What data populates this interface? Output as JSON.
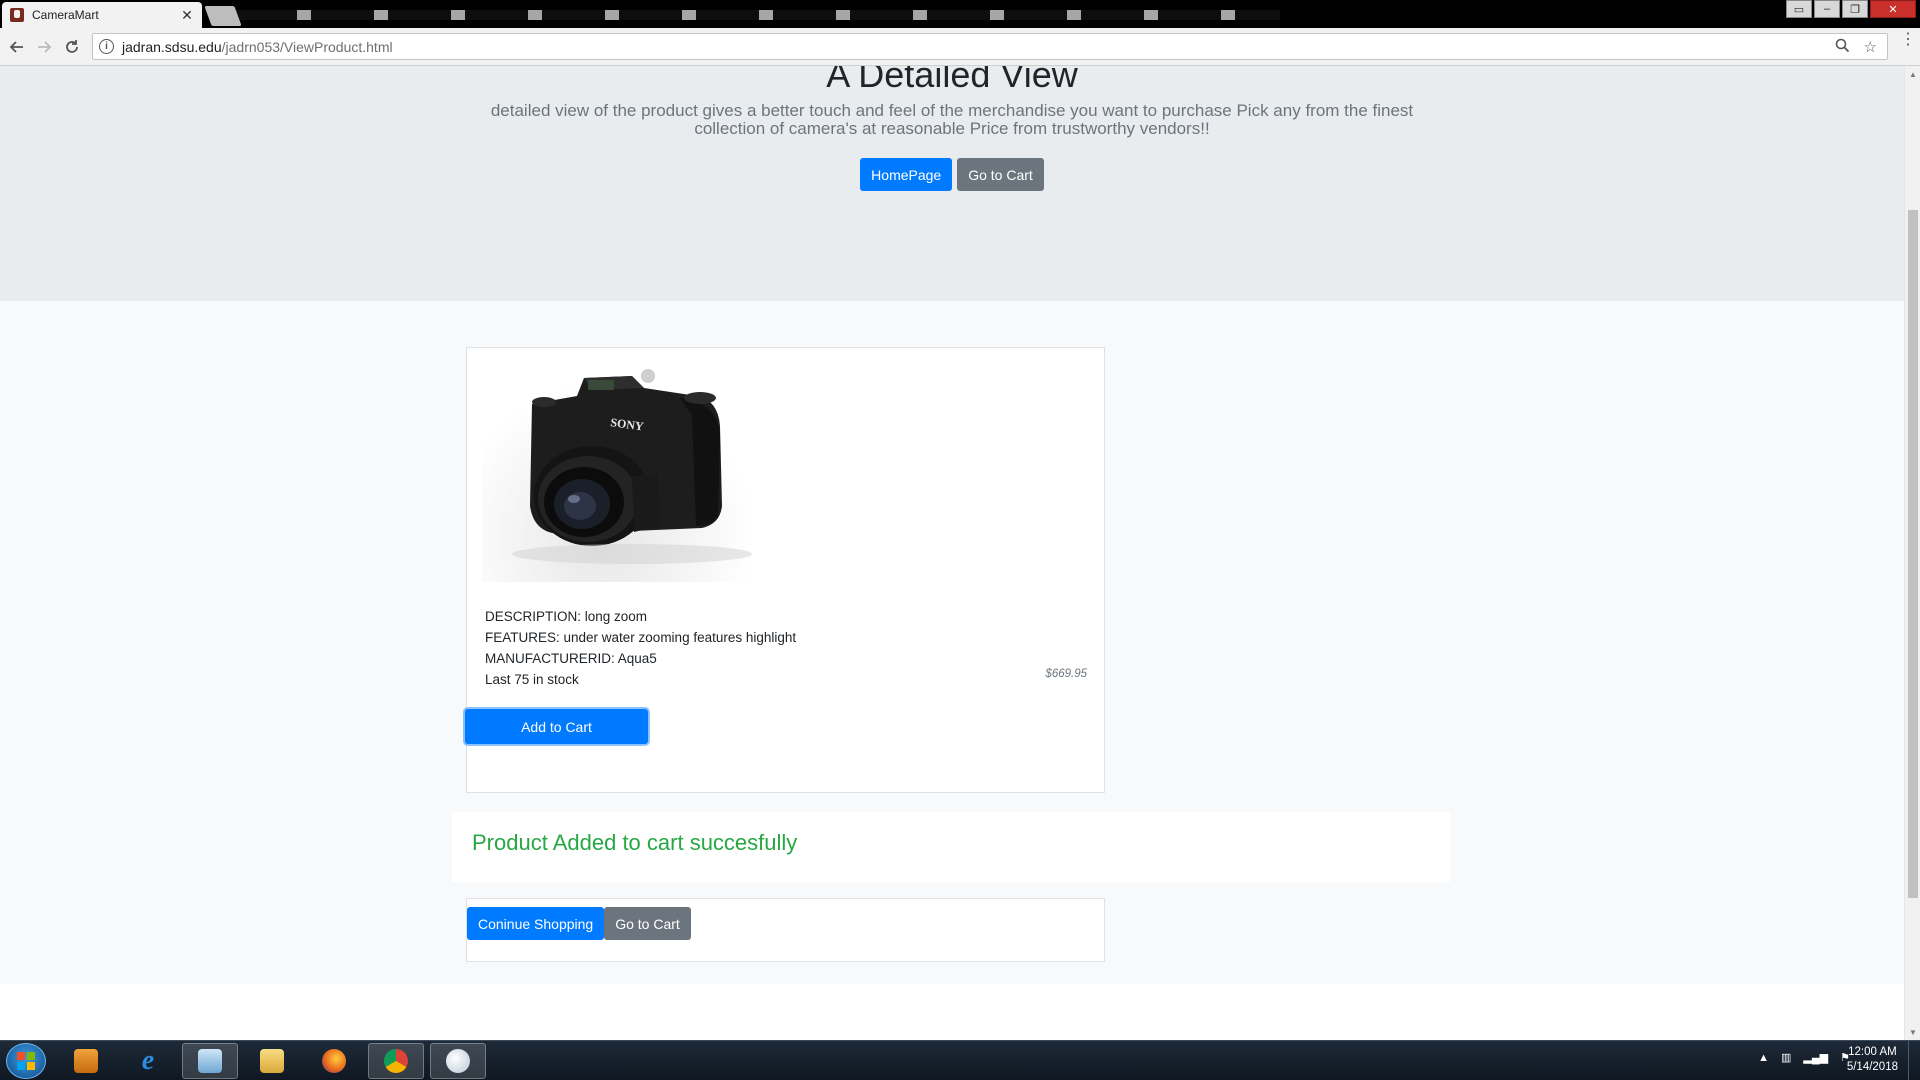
{
  "browser": {
    "tab_title": "CameraMart",
    "tab_close": "✕",
    "url_host": "jadran.sdsu.edu",
    "url_path": "/jadrn053/ViewProduct.html"
  },
  "hero": {
    "title": "A Detailed View",
    "lead": "detailed view of the product gives a better touch and feel of the merchandise you want to purchase Pick any from the finest collection of camera's at reasonable Price from trustworthy vendors!!",
    "homepage_button": "HomePage",
    "cart_button": "Go to Cart"
  },
  "product": {
    "image_brand": "SONY",
    "description": "DESCRIPTION: long zoom",
    "features": "FEATURES: under water zooming features highlight",
    "manufacturer": "MANUFACTURERID: Aqua5",
    "stock": "Last 75 in stock",
    "price": "$669.95",
    "add_button": "Add to Cart"
  },
  "message": {
    "success": "Product Added to cart succesfully"
  },
  "actions": {
    "continue_button": "Coninue Shopping",
    "cart_button": "Go to Cart"
  },
  "taskbar": {
    "time": "12:00 AM",
    "date": "5/14/2018"
  },
  "colors": {
    "primary": "#007bff",
    "secondary": "#6c757d",
    "success": "#28a745",
    "jumbotron_bg": "#e9ecef"
  },
  "icons": [
    "back-arrow-icon",
    "forward-arrow-icon",
    "reload-icon",
    "info-icon",
    "zoom-icon",
    "star-icon",
    "menu-icon",
    "camera-image",
    "windows-start-icon",
    "media-player-icon",
    "internet-explorer-icon",
    "file-manager-icon",
    "folder-icon",
    "firefox-icon",
    "chrome-icon",
    "paint-icon"
  ]
}
